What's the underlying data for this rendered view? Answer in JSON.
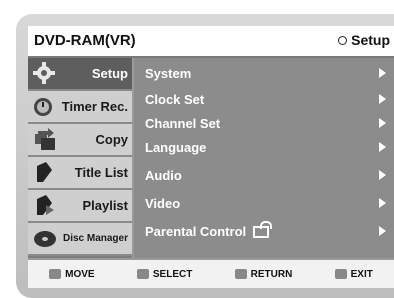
{
  "header": {
    "title": "DVD-RAM(VR)",
    "mode_label": "Setup"
  },
  "sidebar": {
    "items": [
      {
        "label": "Setup",
        "icon": "gear-icon",
        "active": true
      },
      {
        "label": "Timer Rec.",
        "icon": "clock-icon",
        "active": false
      },
      {
        "label": "Copy",
        "icon": "copy-icon",
        "active": false
      },
      {
        "label": "Title List",
        "icon": "title-list-icon",
        "active": false
      },
      {
        "label": "Playlist",
        "icon": "playlist-icon",
        "active": false
      },
      {
        "label": "Disc Manager",
        "icon": "disc-icon",
        "active": false
      }
    ]
  },
  "menu": {
    "items": [
      {
        "label": "System"
      },
      {
        "label": "Clock Set"
      },
      {
        "label": "Channel Set"
      },
      {
        "label": "Language"
      },
      {
        "label": "Audio"
      },
      {
        "label": "Video"
      },
      {
        "label": "Parental Control"
      }
    ]
  },
  "footer": {
    "move": "MOVE",
    "select": "SELECT",
    "return": "RETURN",
    "exit": "EXIT"
  }
}
